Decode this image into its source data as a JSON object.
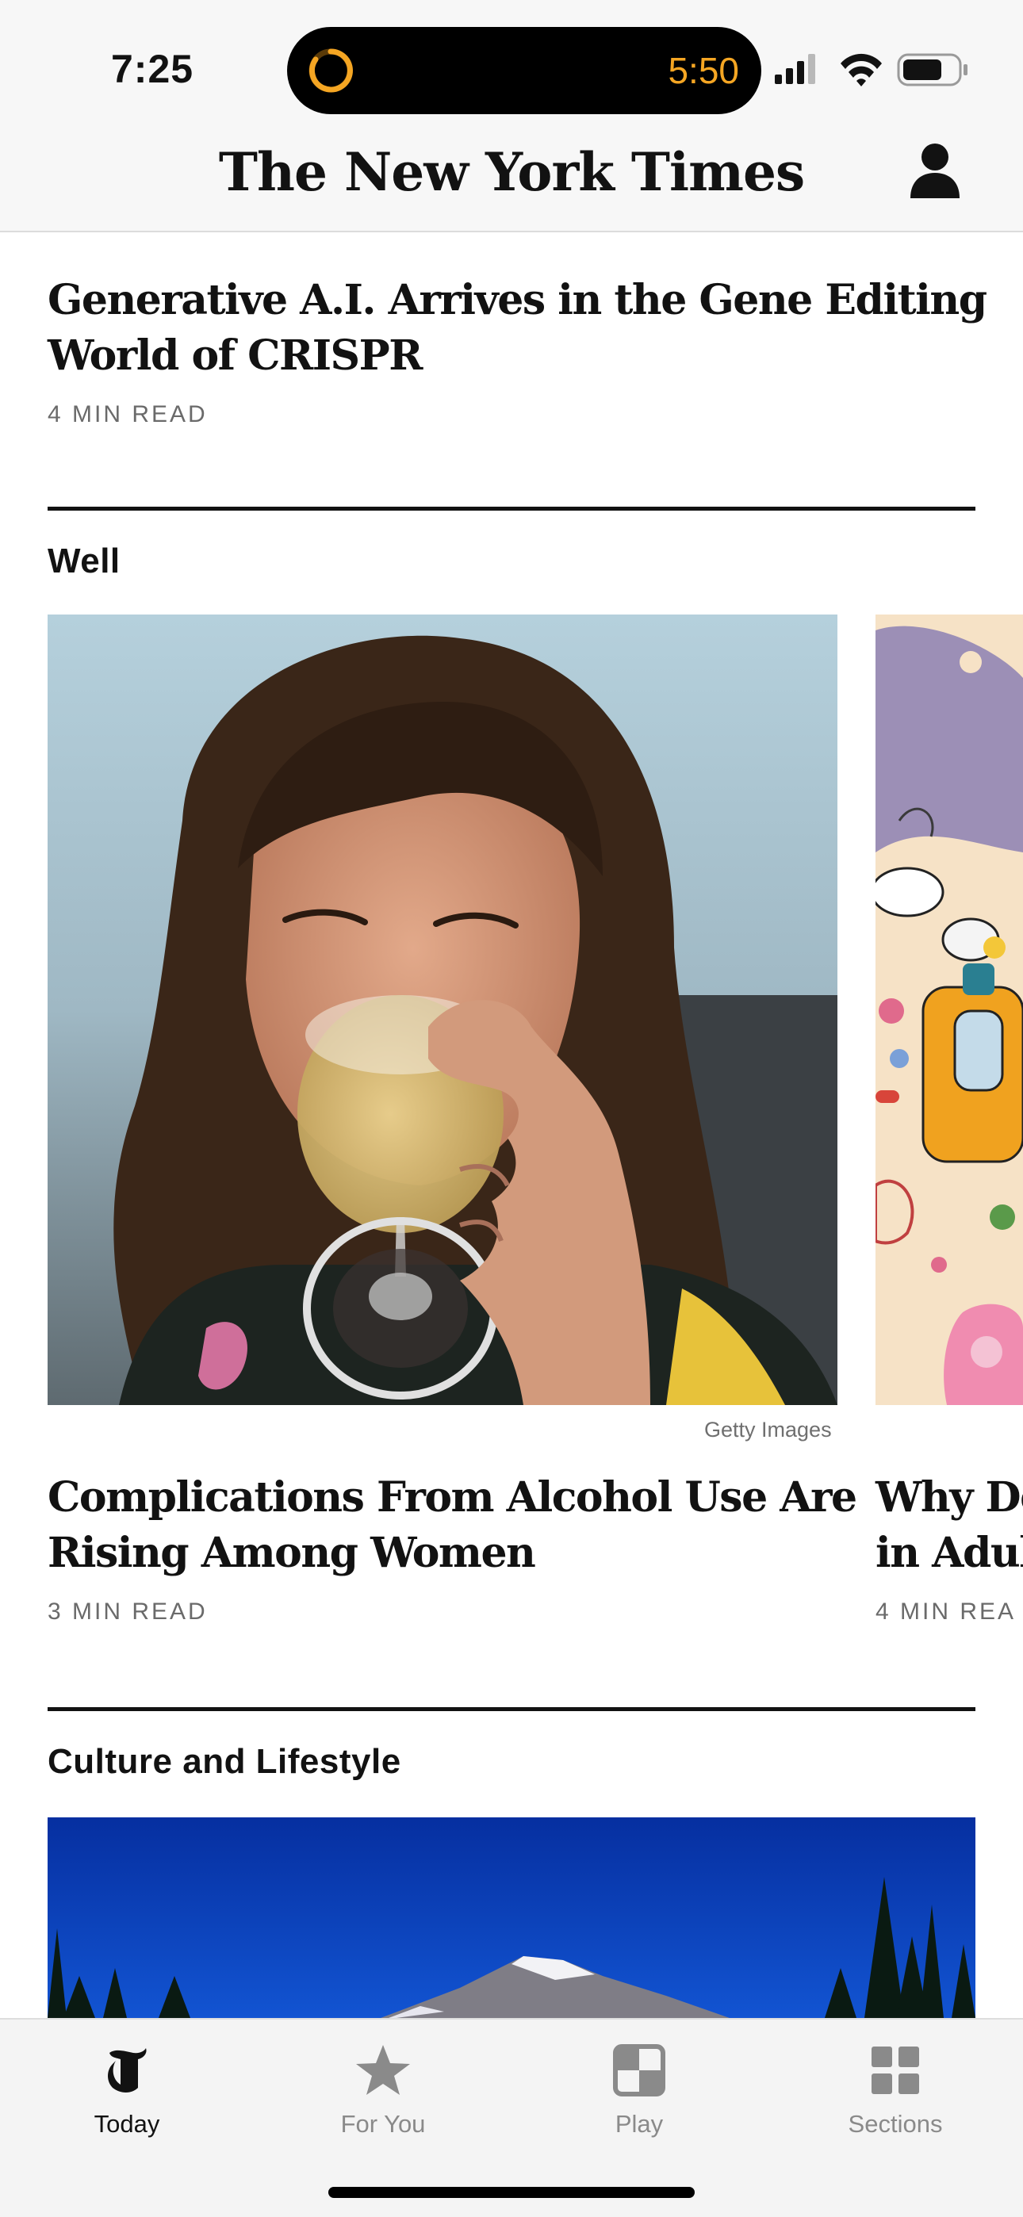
{
  "status_bar": {
    "time": "7:25",
    "live_activity_timer": "5:50",
    "icons": [
      "cellular-signal-icon",
      "wifi-icon",
      "battery-icon"
    ]
  },
  "header": {
    "title": "The New York Times",
    "icons": [
      "profile-icon"
    ]
  },
  "articles": {
    "top": {
      "headline_line1": "Generative A.I. Arrives in the Gene Editing",
      "headline_line2": "World of CRISPR",
      "read_time": "4 MIN READ"
    }
  },
  "sections": {
    "well": {
      "title": "Well",
      "cards": [
        {
          "photo_credit": "Getty Images",
          "headline_line1": "Complications From Alcohol Use Are",
          "headline_line2": "Rising Among Women",
          "read_time": "3 MIN READ"
        },
        {
          "headline_line1": "Why De",
          "headline_line2": "in Adul",
          "read_time": "4 MIN REA"
        }
      ]
    },
    "culture": {
      "title": "Culture and Lifestyle"
    }
  },
  "tab_bar": {
    "tabs": [
      {
        "label": "Today",
        "icon": "nyt-t-logo-icon",
        "active": true
      },
      {
        "label": "For You",
        "icon": "star-icon",
        "active": false
      },
      {
        "label": "Play",
        "icon": "play-games-icon",
        "active": false
      },
      {
        "label": "Sections",
        "icon": "sections-grid-icon",
        "active": false
      }
    ]
  },
  "colors": {
    "text": "#121212",
    "muted": "#6a6a6a",
    "timer_accent": "#f5a623",
    "sky_blue": "#0a3fb8"
  }
}
